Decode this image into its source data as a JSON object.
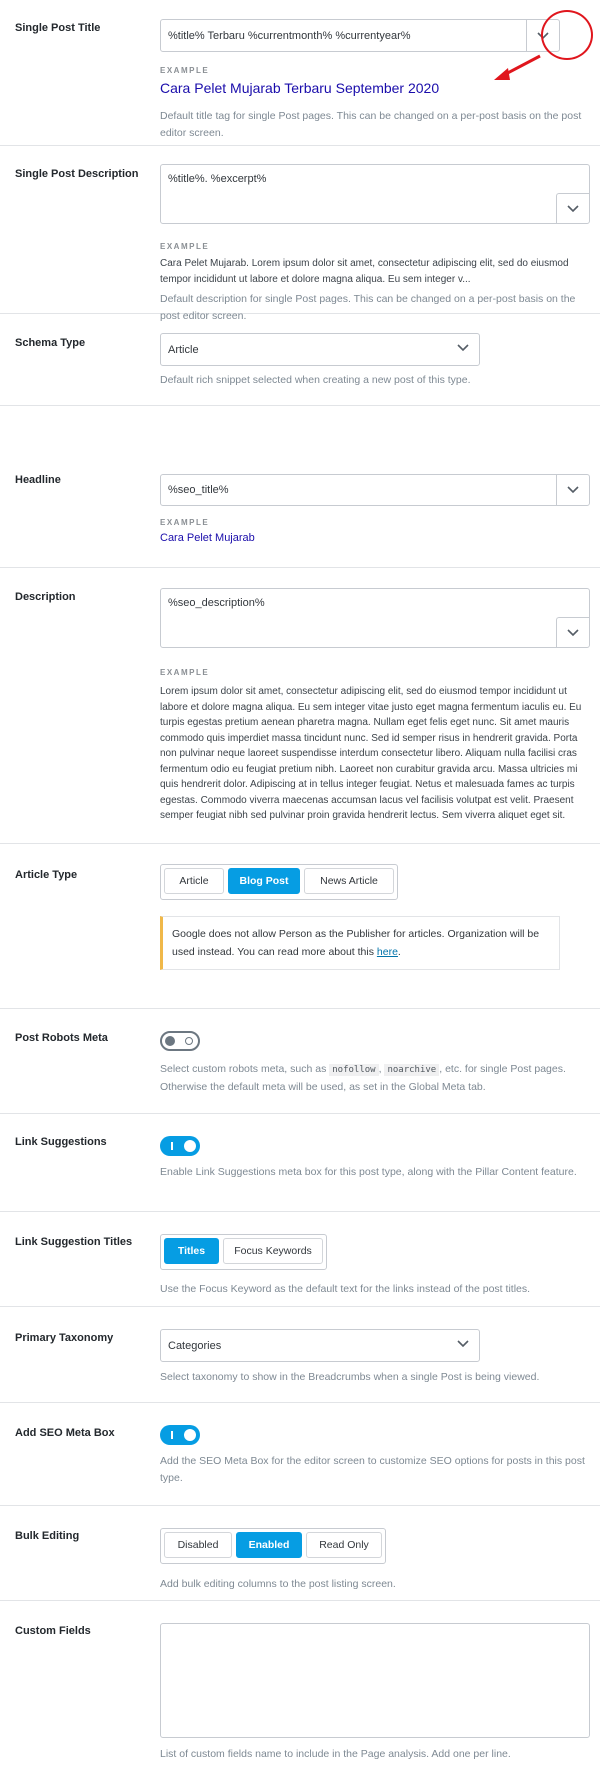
{
  "single_post_title": {
    "label": "Single Post Title",
    "value": "%title% Terbaru %currentmonth% %currentyear%",
    "example_label": "EXAMPLE",
    "example": "Cara Pelet Mujarab Terbaru September 2020",
    "help": "Default title tag for single Post pages. This can be changed on a per-post basis on the post editor screen."
  },
  "single_post_description": {
    "label": "Single Post Description",
    "value": "%title%. %excerpt%",
    "example_label": "EXAMPLE",
    "example": "Cara Pelet Mujarab. Lorem ipsum dolor sit amet, consectetur adipiscing elit, sed do eiusmod tempor incididunt ut labore et dolore magna aliqua. Eu sem integer v...",
    "help": "Default description for single Post pages. This can be changed on a per-post basis on the post editor screen."
  },
  "schema_type": {
    "label": "Schema Type",
    "value": "Article",
    "help": "Default rich snippet selected when creating a new post of this type."
  },
  "headline": {
    "label": "Headline",
    "value": "%seo_title%",
    "example_label": "EXAMPLE",
    "example": "Cara Pelet Mujarab"
  },
  "description": {
    "label": "Description",
    "value": "%seo_description%",
    "example_label": "EXAMPLE",
    "example": "Lorem ipsum dolor sit amet, consectetur adipiscing elit, sed do eiusmod tempor incididunt ut labore et dolore magna aliqua. Eu sem integer vitae justo eget magna fermentum iaculis eu. Eu turpis egestas pretium aenean pharetra magna. Nullam eget felis eget nunc. Sit amet mauris commodo quis imperdiet massa tincidunt nunc. Sed id semper risus in hendrerit gravida. Porta non pulvinar neque laoreet suspendisse interdum consectetur libero. Aliquam nulla facilisi cras fermentum odio eu feugiat pretium nibh. Laoreet non curabitur gravida arcu. Massa ultricies mi quis hendrerit dolor. Adipiscing at in tellus integer feugiat. Netus et malesuada fames ac turpis egestas. Commodo viverra maecenas accumsan lacus vel facilisis volutpat est velit. Praesent semper feugiat nibh sed pulvinar proin gravida hendrerit lectus. Sem viverra aliquet eget sit."
  },
  "article_type": {
    "label": "Article Type",
    "options": [
      "Article",
      "Blog Post",
      "News Article"
    ],
    "selected": "Blog Post",
    "notice_text": "Google does not allow Person as the Publisher for articles. Organization will be used instead. You can read more about this ",
    "notice_link": "here",
    "notice_end": "."
  },
  "post_robots_meta": {
    "label": "Post Robots Meta",
    "state": "off",
    "help_1": "Select custom robots meta, such as ",
    "code_1": "nofollow",
    "sep": ", ",
    "code_2": "noarchive",
    "help_2": ", etc. for single Post pages. Otherwise the default meta will be used, as set in the Global Meta tab."
  },
  "link_suggestions": {
    "label": "Link Suggestions",
    "state": "on",
    "help": "Enable Link Suggestions meta box for this post type, along with the Pillar Content feature."
  },
  "link_suggestion_titles": {
    "label": "Link Suggestion Titles",
    "options": [
      "Titles",
      "Focus Keywords"
    ],
    "selected": "Titles",
    "help": "Use the Focus Keyword as the default text for the links instead of the post titles."
  },
  "primary_taxonomy": {
    "label": "Primary Taxonomy",
    "value": "Categories",
    "help": "Select taxonomy to show in the Breadcrumbs when a single Post is being viewed."
  },
  "add_seo_meta_box": {
    "label": "Add SEO Meta Box",
    "state": "on",
    "help": "Add the SEO Meta Box for the editor screen to customize SEO options for posts in this post type."
  },
  "bulk_editing": {
    "label": "Bulk Editing",
    "options": [
      "Disabled",
      "Enabled",
      "Read Only"
    ],
    "selected": "Enabled",
    "help": "Add bulk editing columns to the post listing screen."
  },
  "custom_fields": {
    "label": "Custom Fields",
    "value": "",
    "help": "List of custom fields name to include in the Page analysis. Add one per line."
  },
  "colors": {
    "accent": "#069de3",
    "annotation": "#e0161d",
    "link": "#1a0dab",
    "notice_border": "#f0b849"
  }
}
